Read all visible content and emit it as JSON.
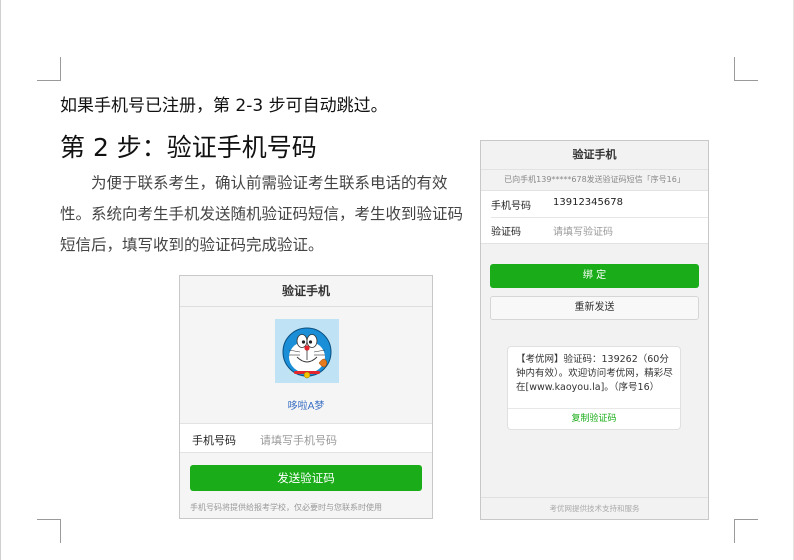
{
  "document": {
    "intro": "如果手机号已注册，第 2-3 步可自动跳过。",
    "step_title": "第 2 步：验证手机号码",
    "paragraph": "为便于联系考生，确认前需验证考生联系电话的有效性。系统向考生手机发送随机验证码短信，考生收到验证码短信后，填写收到的验证码完成验证。"
  },
  "screen1": {
    "header": "验证手机",
    "avatar_icon": "doraemon-avatar",
    "user_name": "哆啦A梦",
    "phone_label": "手机号码",
    "phone_placeholder": "请填写手机号码",
    "send_button": "发送验证码",
    "note": "手机号码将提供给报考学校，仅必要时与您联系时使用"
  },
  "screen2": {
    "header": "验证手机",
    "sent_notice": "已向手机139*****678发送验证码短信「序号16」",
    "phone_label": "手机号码",
    "phone_value": "13912345678",
    "code_label": "验证码",
    "code_placeholder": "请填写验证码",
    "bind_button": "绑 定",
    "resend_button": "重新发送",
    "sms_text": "【考优网】验证码：139262（60分钟内有效）。欢迎访问考优网，精彩尽在[www.kaoyou.la]。（序号16）",
    "copy_button": "复制验证码",
    "footer": "考优网提供技术支持和服务"
  },
  "colors": {
    "primary_green": "#1aad19",
    "link_blue": "#3a6fc3"
  }
}
